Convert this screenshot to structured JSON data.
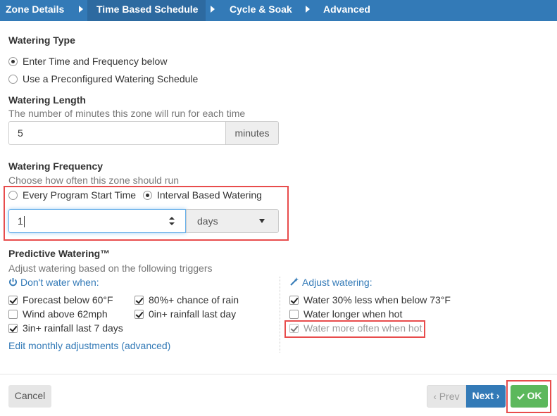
{
  "tabs": [
    {
      "label": "Zone Details"
    },
    {
      "label": "Time Based Schedule"
    },
    {
      "label": "Cycle & Soak"
    },
    {
      "label": "Advanced"
    }
  ],
  "watering_type": {
    "title": "Watering Type",
    "options": [
      "Enter Time and Frequency below",
      "Use a Preconfigured Watering Schedule"
    ],
    "selected": "Enter Time and Frequency below"
  },
  "watering_length": {
    "title": "Watering Length",
    "help": "The number of minutes this zone will run for each time",
    "value": "5",
    "unit": "minutes"
  },
  "watering_frequency": {
    "title": "Watering Frequency",
    "help": "Choose how often this zone should run",
    "options": [
      "Every Program Start Time",
      "Interval Based Watering"
    ],
    "selected": "Interval Based Watering",
    "interval_value": "1",
    "interval_unit": "days"
  },
  "predictive": {
    "title": "Predictive Watering™",
    "help": "Adjust watering based on the following triggers",
    "dont_water_header": "Don't water when:",
    "adjust_header": "Adjust watering:",
    "dont_water": [
      {
        "label": "Forecast below 60°F",
        "checked": true
      },
      {
        "label": "80%+ chance of rain",
        "checked": true
      },
      {
        "label": "Wind above 62mph",
        "checked": false
      },
      {
        "label": "0in+ rainfall last day",
        "checked": true
      },
      {
        "label": "3in+ rainfall last 7 days",
        "checked": true
      }
    ],
    "adjust": [
      {
        "label": "Water 30% less when below 73°F",
        "checked": true
      },
      {
        "label": "Water longer when hot",
        "checked": false
      },
      {
        "label": "Water more often when hot",
        "checked": true
      }
    ],
    "monthly_link": "Edit monthly adjustments (advanced)"
  },
  "footer": {
    "cancel": "Cancel",
    "prev": "Prev",
    "next": "Next",
    "ok": "OK"
  },
  "colors": {
    "tabbar": "#337ab7",
    "primary": "#337ab7",
    "success": "#5cb85c",
    "highlight": "#e84c4c"
  }
}
